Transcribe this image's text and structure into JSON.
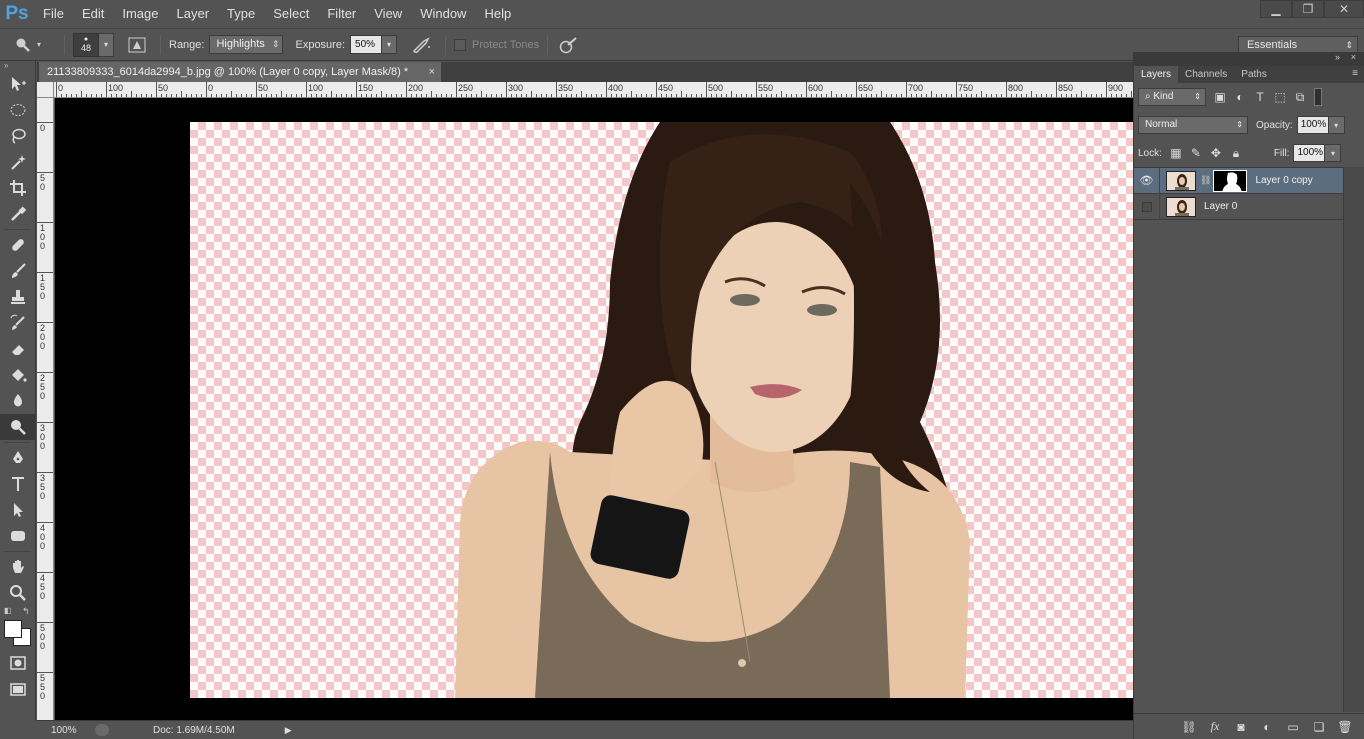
{
  "app": {
    "logo": "Ps",
    "menu": [
      "File",
      "Edit",
      "Image",
      "Layer",
      "Type",
      "Select",
      "Filter",
      "View",
      "Window",
      "Help"
    ]
  },
  "window_controls": {
    "minimize": "▁",
    "restore": "❐",
    "close": "✕"
  },
  "options": {
    "brush_size": "48",
    "range_label": "Range:",
    "range_value": "Highlights",
    "exposure_label": "Exposure:",
    "exposure_value": "50%",
    "protect_tones": "Protect Tones",
    "workspace": "Essentials"
  },
  "document": {
    "tab_title": "21133809333_6014da2994_b.jpg @ 100% (Layer 0 copy, Layer Mask/8) *",
    "close_glyph": "×",
    "ruler_top": [
      "0",
      "100",
      "50",
      "0",
      "50",
      "100",
      "150",
      "200",
      "250",
      "300",
      "350",
      "400",
      "450",
      "500",
      "550",
      "600",
      "650",
      "700",
      "750",
      "800",
      "850",
      "900"
    ],
    "ruler_left": [
      "0",
      "5\n0",
      "1\n0\n0",
      "1\n5\n0",
      "2\n0\n0",
      "2\n5\n0",
      "3\n0\n0",
      "3\n5\n0",
      "4\n0\n0",
      "4\n5\n0",
      "5\n0\n0",
      "5\n5\n0"
    ]
  },
  "status": {
    "zoom": "100%",
    "doc": "Doc: 1.69M/4.50M",
    "arrow": "▶"
  },
  "layers_panel": {
    "tabs": [
      "Layers",
      "Channels",
      "Paths"
    ],
    "filter_kind": "Kind",
    "blend_mode": "Normal",
    "opacity_label": "Opacity:",
    "opacity_value": "100%",
    "lock_label": "Lock:",
    "fill_label": "Fill:",
    "fill_value": "100%",
    "layers": [
      {
        "name": "Layer 0 copy",
        "visible": true,
        "selected": true,
        "has_mask": true
      },
      {
        "name": "Layer 0",
        "visible": false,
        "selected": false,
        "has_mask": false
      }
    ]
  },
  "colors": {
    "ui_bg": "#535353",
    "panel_dark": "#3f3f3f",
    "selection": "#5d6d80",
    "transparency_pink": "#f7c7c7",
    "ps_blue": "#4fa3e0"
  }
}
